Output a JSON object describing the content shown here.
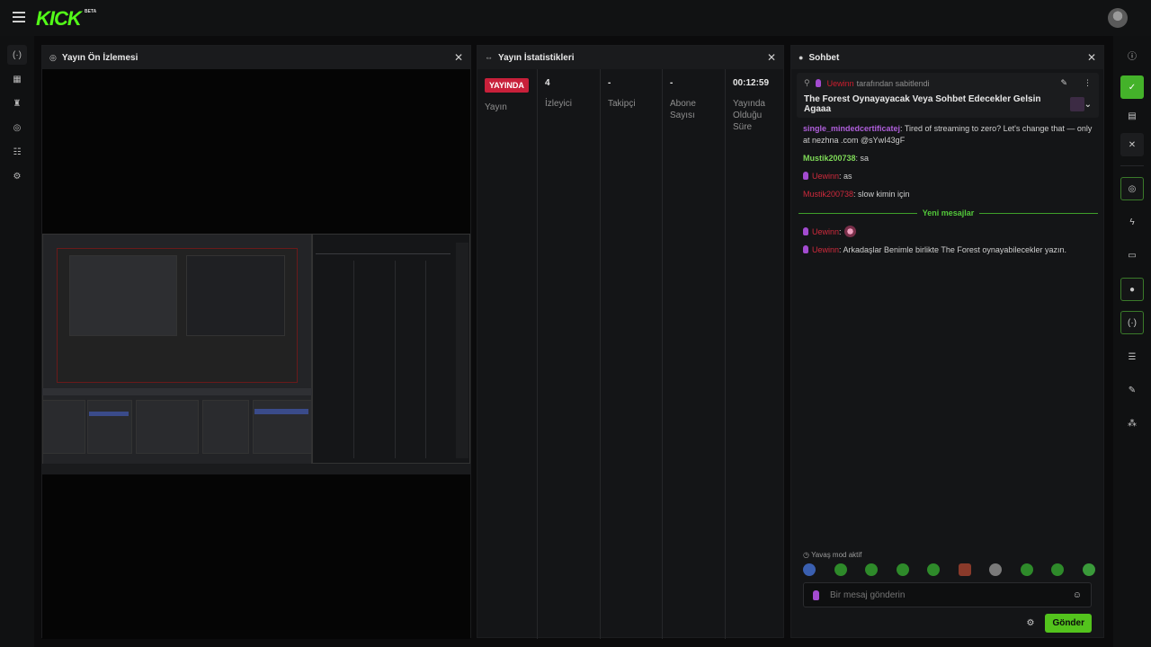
{
  "brand": {
    "logo_text": "KICK",
    "badge": "BETA"
  },
  "panels": {
    "preview": {
      "title": "Yayın Ön İzlemesi",
      "close": "✕"
    },
    "stats": {
      "title": "Yayın İstatistikleri",
      "close": "✕",
      "columns": [
        {
          "value": "YAYINDA",
          "label": "Yayın"
        },
        {
          "value": "4",
          "label": "İzleyici"
        },
        {
          "value": "-",
          "label": "Takipçi"
        },
        {
          "value": "-",
          "label": "Abone Sayısı"
        },
        {
          "value": "00:12:59",
          "label": "Yayında Olduğu Süre"
        }
      ]
    },
    "chat": {
      "title": "Sohbet",
      "close": "✕",
      "pinned": {
        "user": "Uewinn",
        "suffix": "tarafından sabitlendi",
        "message": "The Forest Oynayayacak Veya Sohbet Edecekler Gelsin Agaaa"
      },
      "messages": [
        {
          "user": "single_mindedcertificatej",
          "text": ": Tired of streaming to zero? Let's change that — only at nezhna .com @sYwI43gF"
        },
        {
          "user": "Mustik200738",
          "text": ": sa"
        },
        {
          "user": "Uewinn",
          "text": ": as"
        },
        {
          "user": "Mustik200738",
          "text": ": slow kimin için"
        }
      ],
      "new_messages_label": "Yeni mesajlar",
      "messages_new": [
        {
          "user": "Uewinn",
          "text": ":"
        },
        {
          "user": "Uewinn",
          "text": ": Arkadaşlar Benimle birlikte The Forest oynayabilecekler yazın."
        }
      ],
      "slow_mode": "Yavaş mod aktif",
      "input_placeholder": "Bir mesaj gönderin",
      "send_label": "Gönder"
    }
  },
  "colors": {
    "accent_green": "#53fc18",
    "live_red": "#c8203a",
    "send_green": "#53c31d"
  }
}
